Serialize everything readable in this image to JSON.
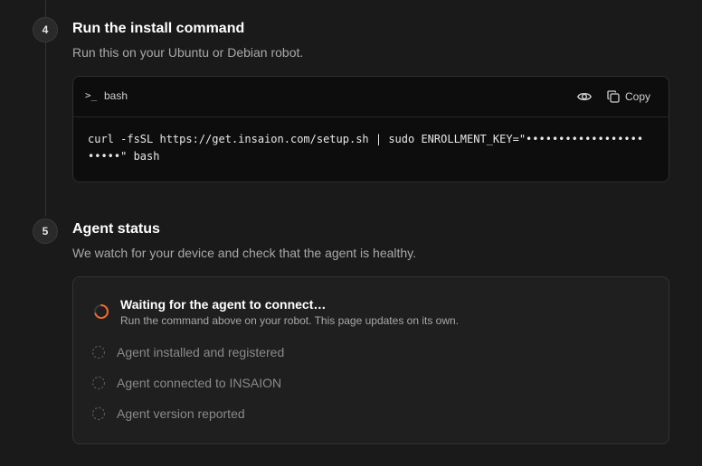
{
  "steps": {
    "install": {
      "number": "4",
      "title": "Run the install command",
      "description": "Run this on your Ubuntu or Debian robot.",
      "code": {
        "prompt_icon": "terminal-prompt-icon",
        "language": "bash",
        "reveal_icon": "eye-icon",
        "copy_icon": "copy-icon",
        "copy_label": "Copy",
        "command": "curl -fsSL https://get.insaion.com/setup.sh | sudo ENROLLMENT_KEY=\"••••••••••••••••••\n•••••\" bash"
      }
    },
    "status": {
      "number": "5",
      "title": "Agent status",
      "description": "We watch for your device and check that the agent is healthy.",
      "waiting": {
        "title": "Waiting for the agent to connect…",
        "subtitle": "Run the command above on your robot. This page updates on its own."
      },
      "checks": [
        {
          "label": "Agent installed and registered"
        },
        {
          "label": "Agent connected to INSAION"
        },
        {
          "label": "Agent version reported"
        }
      ]
    }
  },
  "colors": {
    "background": "#1a1a1a",
    "code_background": "#0d0d0d",
    "card_background": "#1f1f1f",
    "spinner_accent": "#f26b2a",
    "muted_text": "#a8a8a8"
  }
}
